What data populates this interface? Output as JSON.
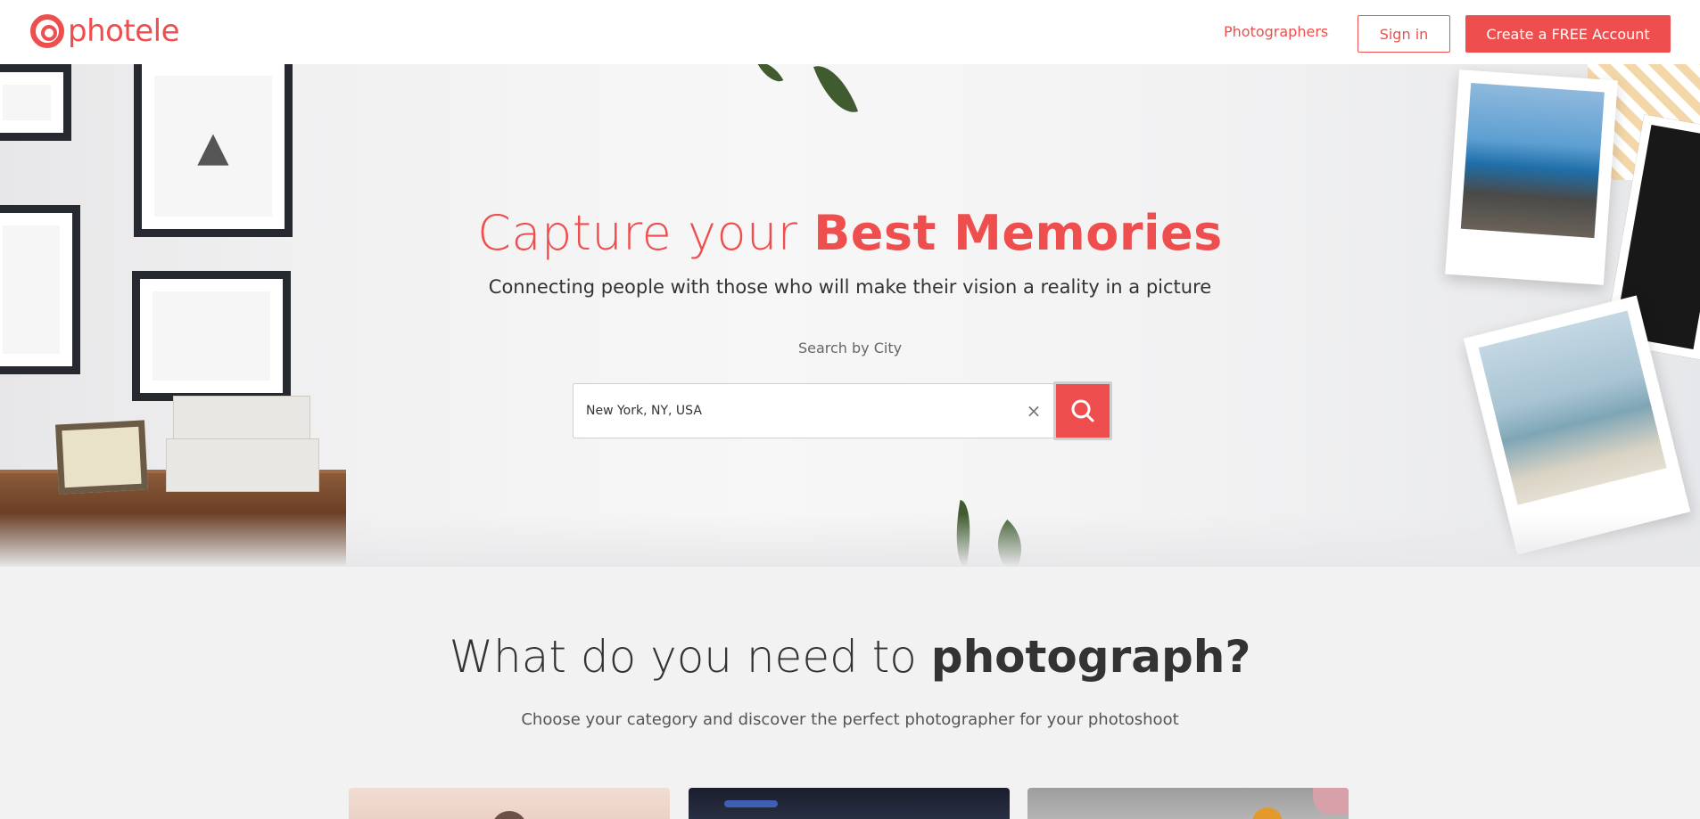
{
  "header": {
    "logo_text": "photele",
    "nav_photographers": "Photographers",
    "signin_label": "Sign in",
    "create_account_label": "Create a FREE Account"
  },
  "hero": {
    "title_light": "Capture your ",
    "title_bold": "Best Memories",
    "subtitle": "Connecting people with those who will make their vision a reality in a picture",
    "search_label": "Search by City",
    "search_value": "New York, NY, USA",
    "clear_icon": "×"
  },
  "categories": {
    "title_light": "What do you need to ",
    "title_bold": "photograph?",
    "subtitle": "Choose your category and discover the perfect photographer for your photoshoot",
    "cards": [
      {
        "name": "category-card-1"
      },
      {
        "name": "category-card-2"
      },
      {
        "name": "category-card-3"
      }
    ]
  },
  "colors": {
    "accent": "#ee4e4d",
    "text": "#333333",
    "section_bg": "#f2f2f2"
  },
  "icons": {
    "logo": "photele-logo-icon",
    "clear": "close-icon",
    "search": "search-icon"
  }
}
